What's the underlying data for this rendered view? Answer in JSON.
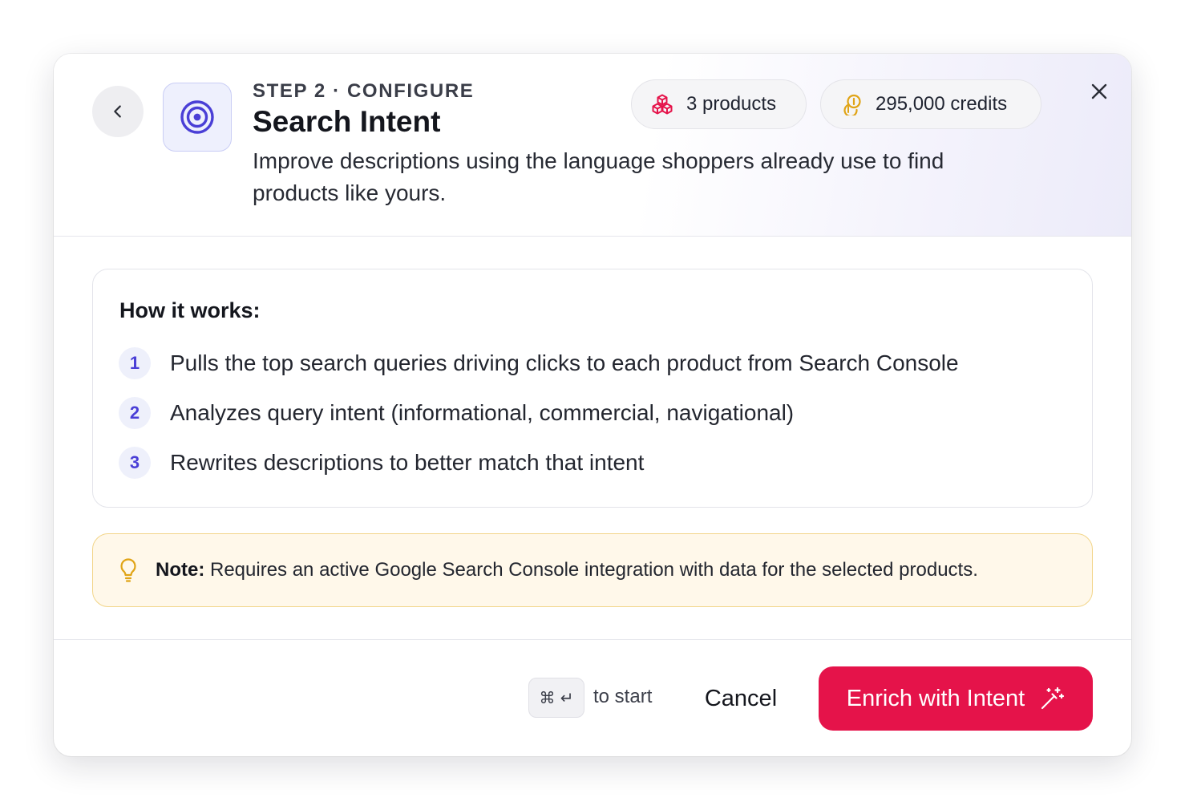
{
  "header": {
    "step_label": "STEP 2 · CONFIGURE",
    "title": "Search Intent",
    "subtitle": "Improve descriptions using the language shoppers already use to find products like yours.",
    "products_badge": "3 products",
    "credits_badge": "295,000 credits",
    "icons": {
      "back": "chevron-left-icon",
      "feature": "target-icon",
      "products": "boxes-icon",
      "credits": "coins-icon",
      "close": "close-icon"
    }
  },
  "how_it_works": {
    "title": "How it works:",
    "steps": [
      {
        "number": "1",
        "text": "Pulls the top search queries driving clicks to each product from Search Console"
      },
      {
        "number": "2",
        "text": "Analyzes query intent (informational, commercial, navigational)"
      },
      {
        "number": "3",
        "text": "Rewrites descriptions to better match that intent"
      }
    ]
  },
  "note": {
    "label": "Note:",
    "text": " Requires an active Google Search Console integration with data for the selected products.",
    "icon": "lightbulb-icon"
  },
  "footer": {
    "shortcut_keys": "⌘ ↵",
    "shortcut_hint": "to start",
    "cancel_label": "Cancel",
    "primary_label": "Enrich with Intent",
    "primary_icon": "magic-wand-icon"
  },
  "colors": {
    "primary": "#e5134a",
    "accent": "#4a3fd6",
    "note_border": "#f2d589",
    "note_bg": "#fff8ea",
    "credits_icon": "#e0a416",
    "products_icon": "#e5134a"
  }
}
